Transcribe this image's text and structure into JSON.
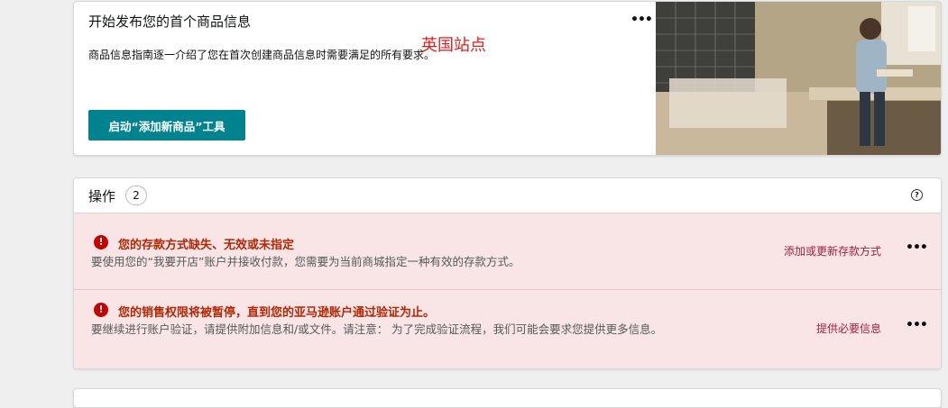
{
  "onboarding": {
    "title": "开始发布您的首个商品信息",
    "description": "商品信息指南逐一介绍了您在首次创建商品信息时需要满足的所有要求。",
    "overlay_text": "英国站点",
    "launch_button": "启动“添加新商品”工具",
    "more_icon": "ellipsis-icon",
    "image": "workshop-photo"
  },
  "actions": {
    "label": "操作",
    "count": "2",
    "help_icon": "question-circle-icon",
    "items": [
      {
        "title": "您的存款方式缺失、无效或未指定",
        "body": "要使用您的“我要开店”账户并接收付款，您需要为当前商城指定一种有效的存款方式。",
        "link": "添加或更新存款方式",
        "icon": "alert-circle-icon"
      },
      {
        "title": "您的销售权限将被暂停，直到您的亚马逊账户通过验证为止。",
        "body": "要继续进行账户验证，请提供附加信息和/或文件。请注意： 为了完成验证流程，我们可能会要求您提供更多信息。",
        "link": "提供必要信息",
        "icon": "alert-circle-icon"
      }
    ]
  },
  "colors": {
    "accent": "#00838f",
    "alert_bg": "#f9e5e6",
    "alert_title": "#b12704",
    "alert_icon": "#c40000",
    "link": "#a0203f",
    "overlay": "#e01e1e"
  }
}
